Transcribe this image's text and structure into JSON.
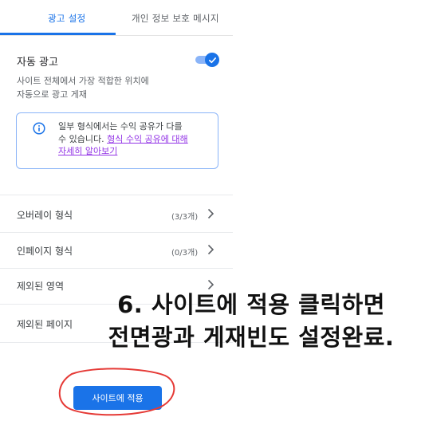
{
  "tabs": [
    {
      "label": "광고 설정",
      "active": true
    },
    {
      "label": "개인 정보 보호 메시지",
      "active": false
    }
  ],
  "auto_ads": {
    "title": "자동 광고",
    "enabled": true,
    "description_line1": "사이트 전체에서 가장 적합한 위치에",
    "description_line2": "자동으로 광고 게재"
  },
  "info": {
    "icon": "info-icon",
    "text_line1": "일부 형식에서는 수익 공유가 다를",
    "text_prefix": "수 있습니다. ",
    "link_part1": "형식 수익 공유에 대해",
    "link_part2": "자세히 알아보기"
  },
  "rows": [
    {
      "label": "오버레이 형식",
      "count": "(3/3개)"
    },
    {
      "label": "인페이지 형식",
      "count": "(0/3개)"
    },
    {
      "label": "제외된 영역",
      "count": ""
    },
    {
      "label": "제외된 페이지",
      "count": ""
    }
  ],
  "caption": {
    "line1": "6. 사이트에 적용 클릭하면",
    "line2": "전면광과 게재빈도 설정완료."
  },
  "apply_button": {
    "label": "사이트에 적용"
  },
  "colors": {
    "accent": "#1a73e8",
    "link": "#9334e6",
    "annotation_circle": "#e53935"
  }
}
